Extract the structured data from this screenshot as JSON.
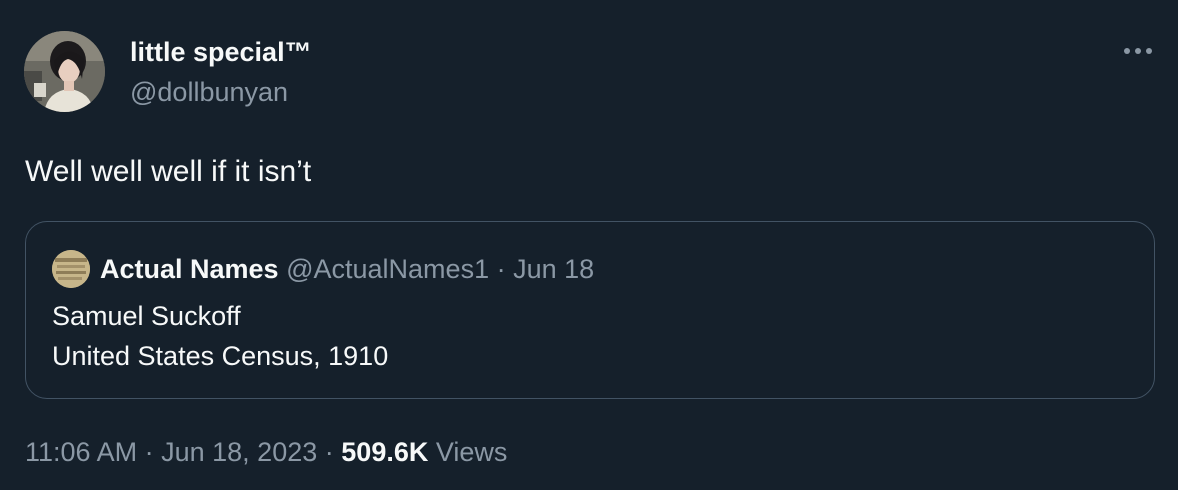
{
  "author": {
    "display_name": "little special™",
    "handle": "@dollbunyan",
    "avatar_icon": "profile-photo"
  },
  "more_icon": "more-horizontal-icon",
  "tweet": {
    "text": "Well well well if it isn’t"
  },
  "quoted_tweet": {
    "display_name": "Actual Names",
    "handle": "@ActualNames1",
    "separator": "·",
    "date": "Jun 18",
    "lines": [
      "Samuel Suckoff",
      "United States Census, 1910"
    ],
    "avatar_icon": "document-thumbnail"
  },
  "meta": {
    "time": "11:06 AM",
    "sep1": "·",
    "date": "Jun 18, 2023",
    "sep2": "·",
    "views_count": "509.6K",
    "views_label": "Views"
  },
  "colors": {
    "background": "#15202b",
    "primary_text": "#f7f9f9",
    "secondary_text": "#8b98a5",
    "border": "#425364"
  }
}
